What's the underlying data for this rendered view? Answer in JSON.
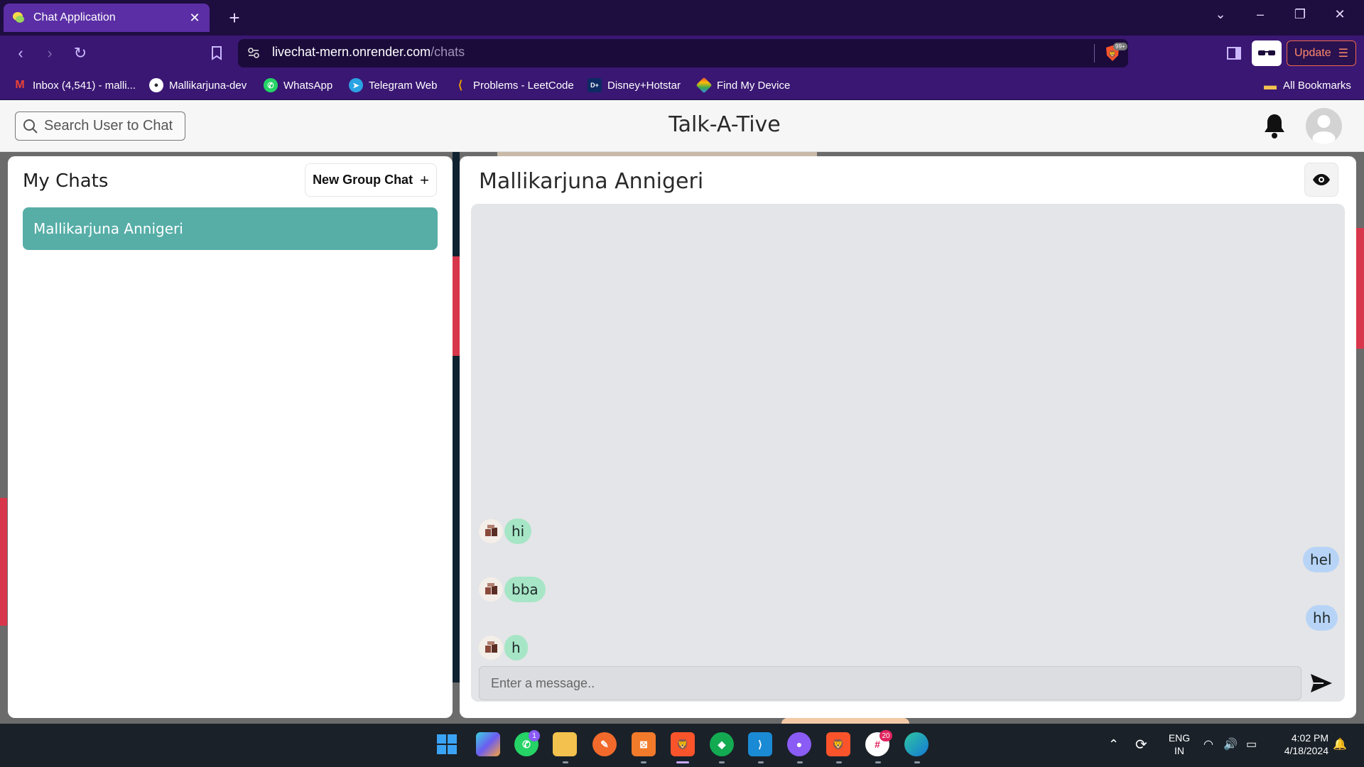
{
  "browser": {
    "tab_title": "Chat Application",
    "url_host": "livechat-mern.onrender.com",
    "url_path": "/chats",
    "shields_badge": "99+",
    "update_label": "Update",
    "bookmarks": [
      {
        "label": "Inbox (4,541) - malli...",
        "icon": "gmail-icon",
        "color": "#ea4335"
      },
      {
        "label": "Mallikarjuna-dev",
        "icon": "github-icon",
        "color": "#24292e"
      },
      {
        "label": "WhatsApp",
        "icon": "whatsapp-icon",
        "color": "#25d366"
      },
      {
        "label": "Telegram Web",
        "icon": "telegram-icon",
        "color": "#2aa3e3"
      },
      {
        "label": "Problems - LeetCode",
        "icon": "leetcode-icon",
        "color": "#f0a000"
      },
      {
        "label": "Disney+Hotstar",
        "icon": "hotstar-icon",
        "color": "#0d2a63"
      },
      {
        "label": "Find My Device",
        "icon": "find-my-device-icon",
        "color": "#34a853"
      }
    ],
    "all_bookmarks_label": "All Bookmarks"
  },
  "app": {
    "search_label": "Search User to Chat",
    "brand": "Talk-A-Tive"
  },
  "sidebar": {
    "title": "My Chats",
    "new_group_label": "New Group Chat",
    "chats": [
      {
        "name": "Mallikarjuna Annigeri",
        "selected": true
      }
    ]
  },
  "chat": {
    "title": "Mallikarjuna Annigeri",
    "messages": [
      {
        "text": "hi",
        "sender": "other"
      },
      {
        "text": "hel",
        "sender": "me"
      },
      {
        "text": "bba",
        "sender": "other"
      },
      {
        "text": "hh",
        "sender": "me"
      },
      {
        "text": "h",
        "sender": "other"
      }
    ],
    "input_placeholder": "Enter a message.."
  },
  "taskbar": {
    "whatsapp_badge": "1",
    "slack_badge": "20",
    "language_line1": "ENG",
    "language_line2": "IN",
    "time": "4:02 PM",
    "date": "4/18/2024"
  },
  "colors": {
    "selected_chat": "#56aea7",
    "incoming_bubble": "#a6e6c6",
    "outgoing_bubble": "#b7d4f7",
    "tab_active": "#5b2ea5"
  }
}
